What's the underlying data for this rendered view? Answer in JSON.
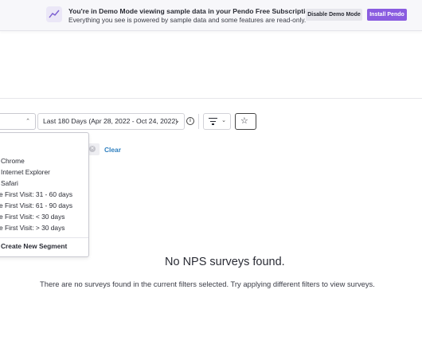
{
  "banner": {
    "icon": "trend-line-icon",
    "title": "You're in Demo Mode viewing sample data in your Pendo Free Subscription",
    "subtitle": "Everything you see is powered by sample data and some features are read-only.",
    "disable_label": "Disable Demo Mode",
    "install_label": "Install Pendo",
    "accent_color": "#8a5ce0"
  },
  "filters": {
    "segment_chevron": "chevron-up-icon",
    "date_range": "Last 180 Days (Apr 28, 2022 - Oct 24, 2022)",
    "clear_label": "Clear"
  },
  "segment_dropdown": {
    "items": [
      "Chrome",
      "Internet Explorer",
      "Safari",
      "e First Visit: 31 - 60 days",
      "e First Visit: 61 - 90 days",
      "e First Visit: < 30 days",
      "e First Visit: > 30 days"
    ],
    "create_label": "Create New Segment"
  },
  "empty_state": {
    "title": "No NPS surveys found.",
    "description": "There are no surveys found in the current filters selected. Try applying different filters to view surveys."
  }
}
